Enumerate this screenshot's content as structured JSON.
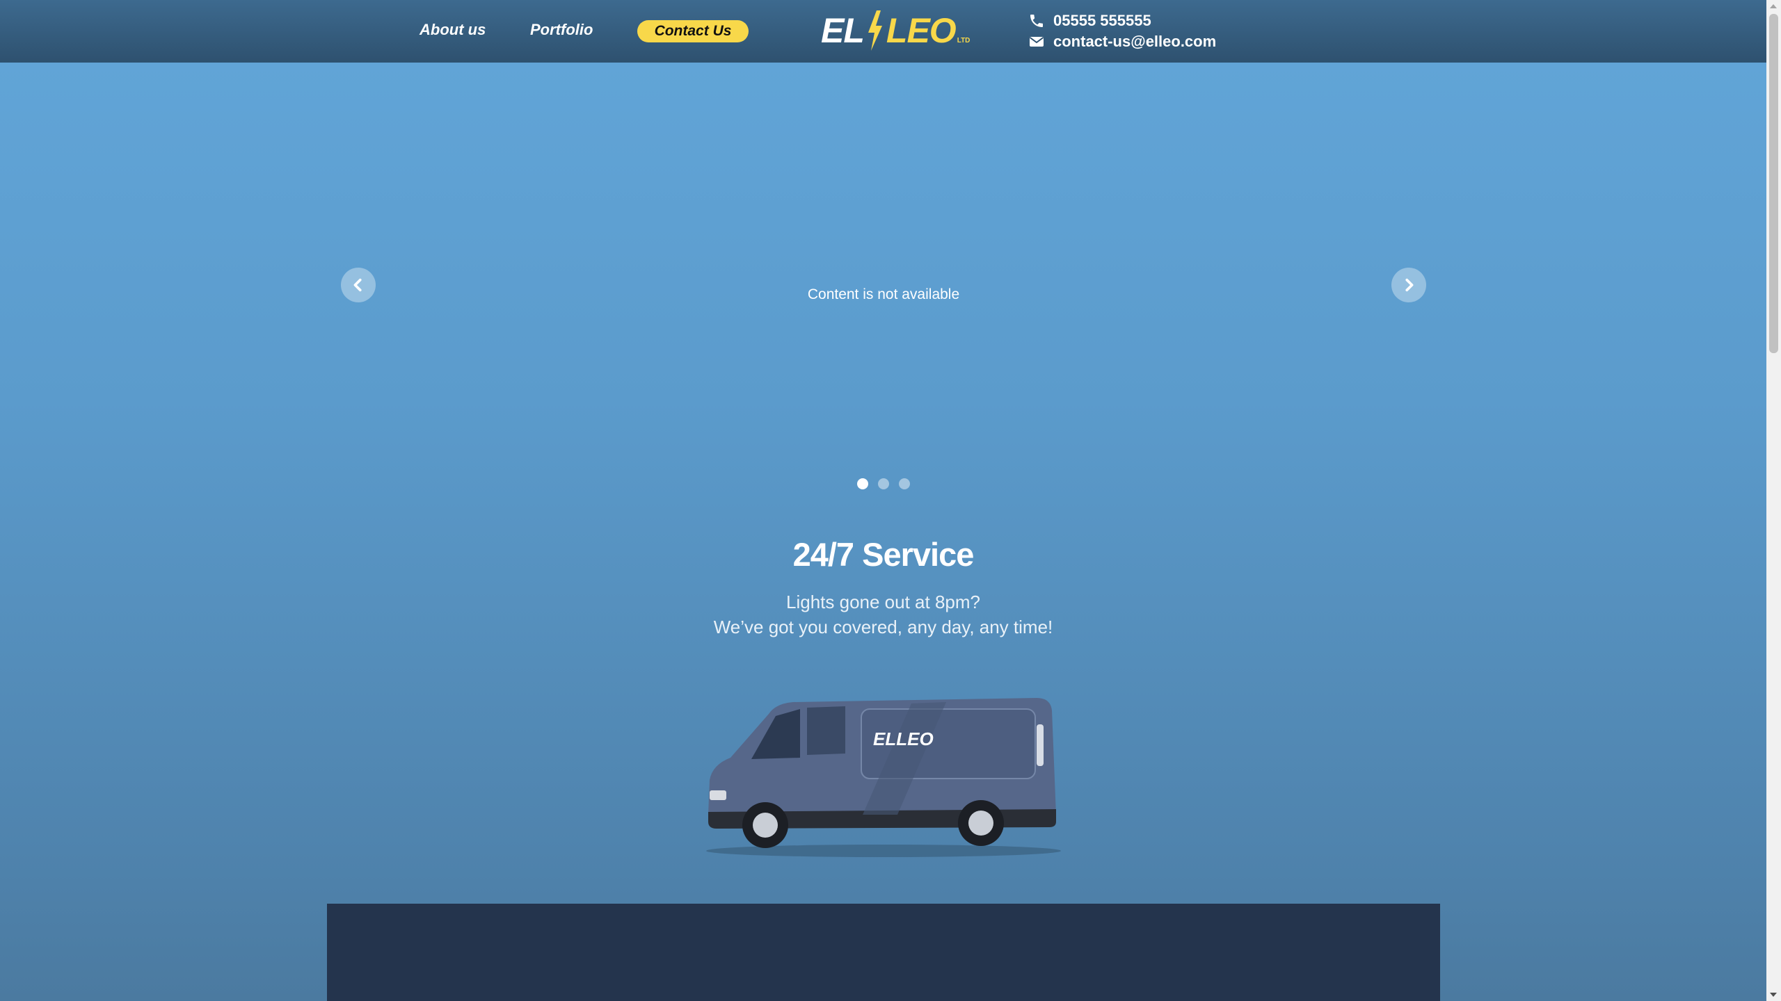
{
  "header": {
    "nav": {
      "about_label": "About us",
      "portfolio_label": "Portfolio",
      "contact_label": "Contact Us"
    },
    "logo": {
      "part1": "EL",
      "part2": "LEO",
      "suffix": "LTD"
    },
    "phone": "05555 555555",
    "email": "contact-us@elleo.com",
    "icons": {
      "phone": "phone-icon",
      "email": "envelope-icon"
    }
  },
  "carousel": {
    "message": "Content is not available",
    "slide_count": 3,
    "active_index": 0,
    "icons": {
      "prev": "chevron-left-icon",
      "next": "chevron-right-icon"
    }
  },
  "service": {
    "title": "24/7 Service",
    "line1": "Lights gone out at 8pm?",
    "line2": "We’ve got you covered, any day, any time!"
  },
  "van": {
    "logo_text": "ELLEO"
  },
  "colors": {
    "accent": "#f8d84a",
    "header": "#2e516f",
    "panel": "#24344d"
  }
}
